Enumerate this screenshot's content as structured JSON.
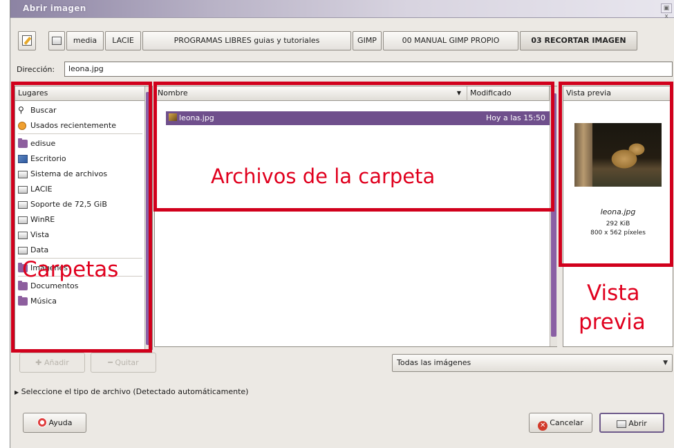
{
  "window": {
    "title": "Abrir imagen",
    "close_glyph": "▣ x"
  },
  "pathbar": {
    "buttons": [
      "media",
      "LACIE",
      "PROGRAMAS LIBRES guias y tutoriales",
      "GIMP",
      "00 MANUAL GIMP PROPIO",
      "03 RECORTAR IMAGEN"
    ],
    "active_index": 5
  },
  "location": {
    "label": "Dirección:",
    "value": "leona.jpg"
  },
  "places": {
    "header": "Lugares",
    "items": [
      {
        "label": "Buscar",
        "icon": "binoculars-icon"
      },
      {
        "label": "Usados recientemente",
        "icon": "recent-icon"
      },
      {
        "label": "edisue",
        "icon": "folder-icon"
      },
      {
        "label": "Escritorio",
        "icon": "desktop-icon"
      },
      {
        "label": "Sistema de archivos",
        "icon": "drive-icon"
      },
      {
        "label": "LACIE",
        "icon": "drive-icon"
      },
      {
        "label": "Soporte de 72,5 GiB",
        "icon": "drive-icon"
      },
      {
        "label": "WinRE",
        "icon": "drive-icon"
      },
      {
        "label": "Vista",
        "icon": "drive-icon"
      },
      {
        "label": "Data",
        "icon": "drive-icon"
      },
      {
        "label": "Imágenes",
        "icon": "folder-icon"
      },
      {
        "label": "Documentos",
        "icon": "folder-icon"
      },
      {
        "label": "Música",
        "icon": "folder-icon"
      }
    ],
    "add_button": "Añadir",
    "remove_button": "Quitar"
  },
  "files": {
    "col_name": "Nombre",
    "col_modified": "Modificado",
    "rows": [
      {
        "name": "leona.jpg",
        "modified": "Hoy a las 15:50",
        "selected": true
      }
    ]
  },
  "preview": {
    "header": "Vista previa",
    "filename": "leona.jpg",
    "size": "292 KiB",
    "dimensions": "800 x 562 píxeles"
  },
  "filter": {
    "selected": "Todas las imágenes"
  },
  "expander": {
    "label": "Seleccione el tipo de archivo (Detectado automáticamente)"
  },
  "buttons": {
    "help": "Ayuda",
    "cancel": "Cancelar",
    "open": "Abrir"
  },
  "annotations": {
    "files": "Archivos de la carpeta",
    "folders": "Carpetas",
    "preview_line1": "Vista",
    "preview_line2": "previa"
  },
  "colors": {
    "selection": "#6f4f8c",
    "annotation": "#d1001c",
    "accent": "#8a5fa4"
  }
}
